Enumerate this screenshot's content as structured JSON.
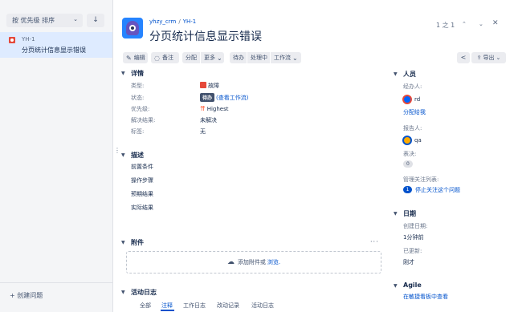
{
  "left": {
    "sort_label": "按 优先级 排序",
    "sort_chevron": "⌄",
    "sort_dir": "↓",
    "issue": {
      "key": "YH-1",
      "summary": "分页统计信息显示错误"
    },
    "create_issue": "+ 创建问题"
  },
  "header": {
    "project": "yhzy_crm",
    "crumb_sep": "/",
    "issue_key": "YH-1",
    "title": "分页统计信息显示错误",
    "pager": "1 之 1",
    "up": "⌃",
    "down": "⌄",
    "close": "✕"
  },
  "toolbar": {
    "edit": "编辑",
    "comment": "备注",
    "assign": "分配",
    "more": "更多",
    "todo": "待办",
    "in_progress": "处理中",
    "workflow": "工作流",
    "export": "导出"
  },
  "details": {
    "title": "详情",
    "labels": {
      "type": "类型:",
      "status": "状态:",
      "priority": "优先级:",
      "resolution": "解决结果:",
      "tags": "标签:"
    },
    "type": "故障",
    "status": "待办",
    "status_link": "(查看工作流)",
    "priority": "Highest",
    "resolution": "未解决",
    "tags": "无"
  },
  "description": {
    "title": "描述",
    "lines": [
      "前置条件",
      "操作步骤",
      "预期结果",
      "实际结果"
    ]
  },
  "attachments": {
    "title": "附件",
    "more": "···",
    "drop_text": "添加附件或",
    "browse": "浏览."
  },
  "activity": {
    "title": "活动日志",
    "tabs": [
      "全部",
      "注释",
      "工作日志",
      "改动记录",
      "活动日志"
    ]
  },
  "people": {
    "title": "人员",
    "assignee_label": "经办人:",
    "assignee": "rd",
    "assign_to_me": "分配给我",
    "reporter_label": "报告人:",
    "reporter": "qa",
    "votes_label": "表决:",
    "votes": "0",
    "watchers_label": "管理关注列表:",
    "watchers": "1",
    "stop_watching": "停止关注这个问题"
  },
  "dates": {
    "title": "日期",
    "created_label": "创建日期:",
    "created": "1分钟前",
    "updated_label": "已更新:",
    "updated": "刚才"
  },
  "agile": {
    "title": "Agile",
    "link": "在敏捷看板中查看"
  },
  "colors": {
    "accent": "#0052cc",
    "bug": "#e5493a",
    "selected_bg": "#deebff"
  }
}
